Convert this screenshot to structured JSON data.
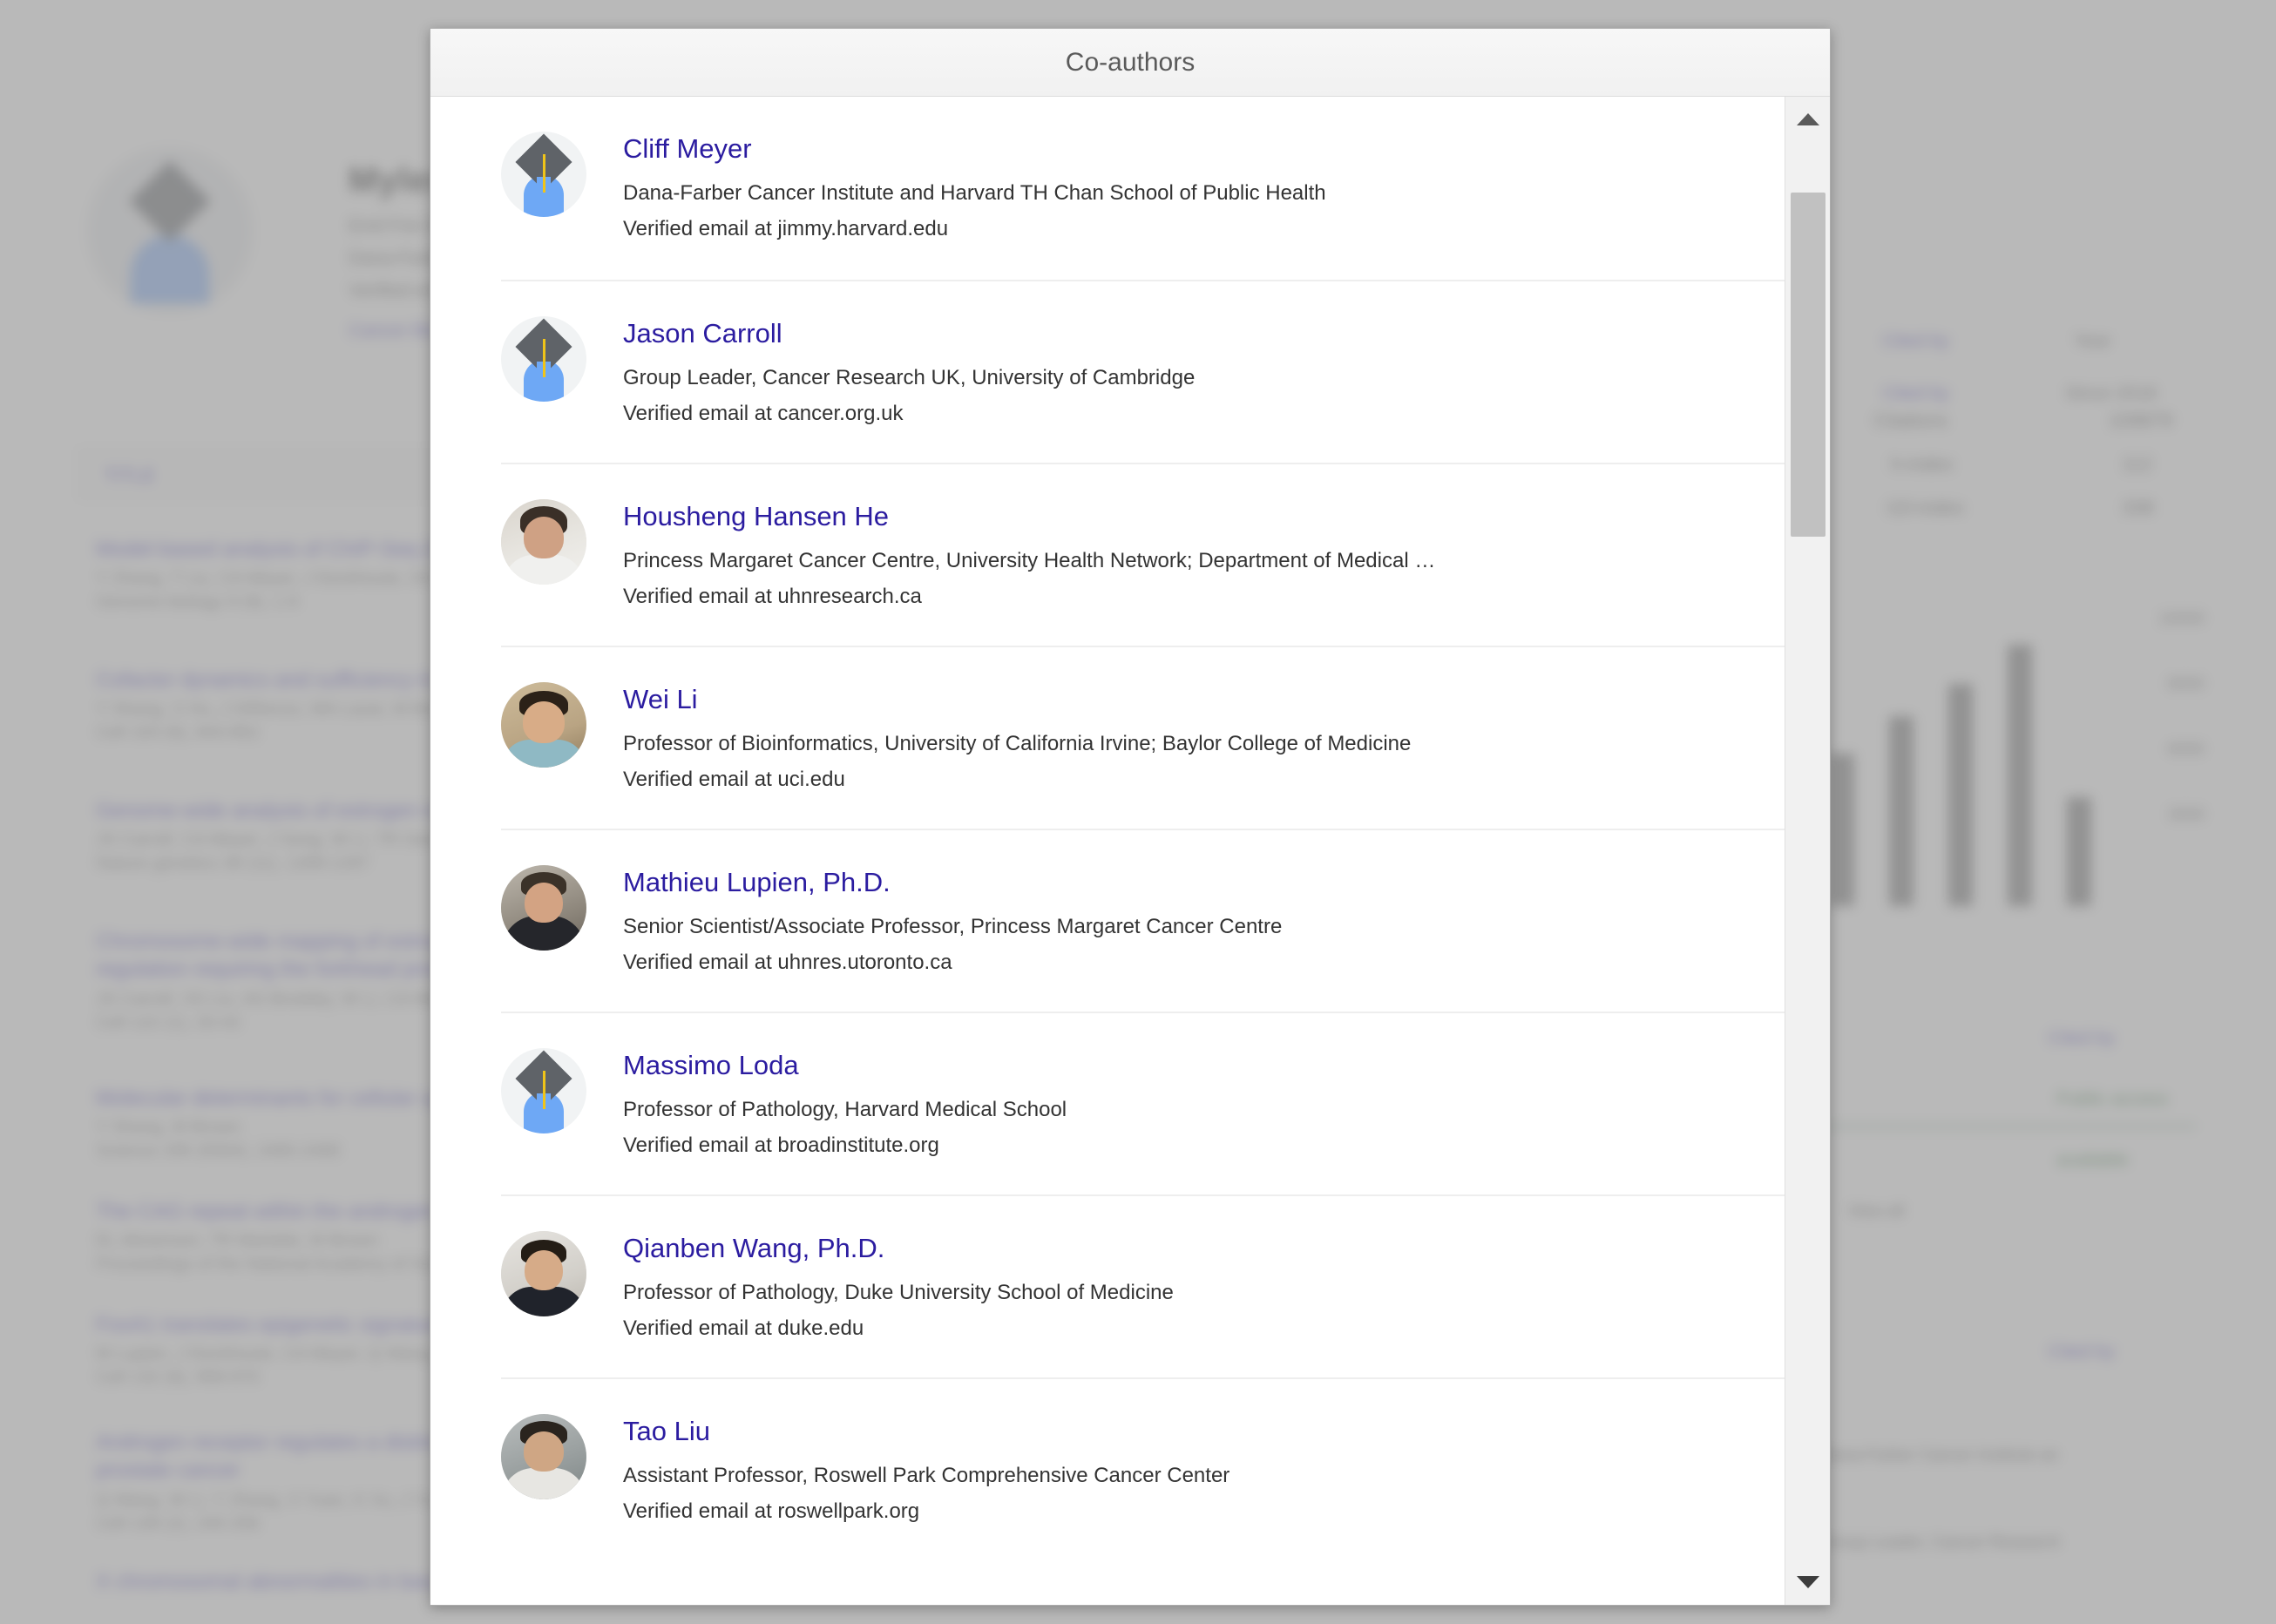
{
  "dialog": {
    "title": "Co-authors",
    "coauthors": [
      {
        "name": "Cliff Meyer",
        "affiliation": "Dana-Farber Cancer Institute and Harvard TH Chan School of Public Health",
        "email": "Verified email at jimmy.harvard.edu",
        "avatar_type": "placeholder",
        "avatar_name": "default-scholar-avatar-icon"
      },
      {
        "name": "Jason Carroll",
        "affiliation": "Group Leader, Cancer Research UK, University of Cambridge",
        "email": "Verified email at cancer.org.uk",
        "avatar_type": "placeholder",
        "avatar_name": "default-scholar-avatar-icon"
      },
      {
        "name": "Housheng Hansen He",
        "affiliation": "Princess Margaret Cancer Centre, University Health Network; Department of Medical …",
        "email": "Verified email at uhnresearch.ca",
        "avatar_type": "photo",
        "avatar_name": "coauthor-photo"
      },
      {
        "name": "Wei Li",
        "affiliation": "Professor of Bioinformatics, University of California Irvine; Baylor College of Medicine",
        "email": "Verified email at uci.edu",
        "avatar_type": "photo",
        "avatar_name": "coauthor-photo"
      },
      {
        "name": "Mathieu Lupien, Ph.D.",
        "affiliation": "Senior Scientist/Associate Professor, Princess Margaret Cancer Centre",
        "email": "Verified email at uhnres.utoronto.ca",
        "avatar_type": "photo",
        "avatar_name": "coauthor-photo"
      },
      {
        "name": "Massimo Loda",
        "affiliation": "Professor of Pathology, Harvard Medical School",
        "email": "Verified email at broadinstitute.org",
        "avatar_type": "placeholder",
        "avatar_name": "default-scholar-avatar-icon"
      },
      {
        "name": "Qianben Wang, Ph.D.",
        "affiliation": "Professor of Pathology, Duke University School of Medicine",
        "email": "Verified email at duke.edu",
        "avatar_type": "photo",
        "avatar_name": "coauthor-photo"
      },
      {
        "name": "Tao Liu",
        "affiliation": "Assistant Professor, Roswell Park Comprehensive Cancer Center",
        "email": "Verified email at roswellpark.org",
        "avatar_type": "photo",
        "avatar_name": "coauthor-photo"
      }
    ]
  },
  "scrollbar": {
    "up_arrow": "scroll-up-arrow-icon",
    "down_arrow": "scroll-down-arrow-icon"
  },
  "colors": {
    "link": "#2b1ca0",
    "dialog_header_bg": "#f1f1f1",
    "body_bg": "#ffffff",
    "separator": "#eeeeee",
    "scroll_thumb": "#c1c1c1",
    "overlay": "rgba(128,128,128,0.55)"
  }
}
